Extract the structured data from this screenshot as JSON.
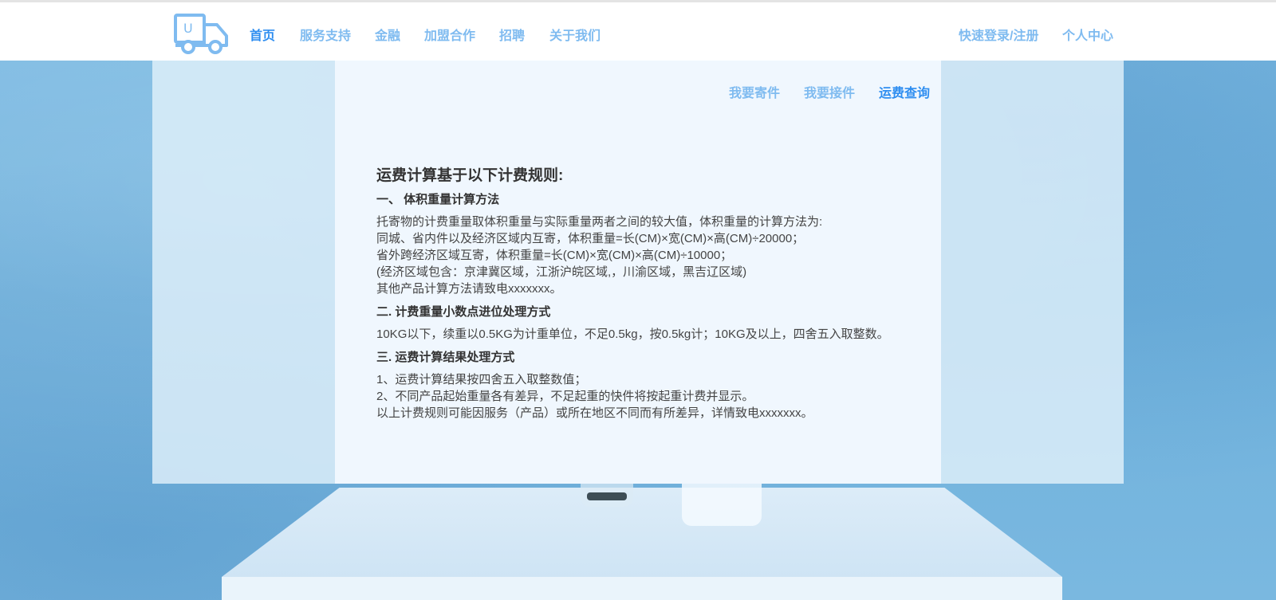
{
  "header": {
    "logo_letter": "U",
    "nav": [
      "首页",
      "服务支持",
      "金融",
      "加盟合作",
      "招聘",
      "关于我们"
    ],
    "active_index": 0,
    "login_label": "快速登录/注册",
    "user_center_label": "个人中心"
  },
  "subnav": {
    "items": [
      "我要寄件",
      "我要接件",
      "运费查询"
    ],
    "active_index": 2
  },
  "content": {
    "title": "运费计算基于以下计费规则:",
    "sections": [
      {
        "heading": "一、 体积重量计算方法",
        "lines": [
          "托寄物的计费重量取体积重量与实际重量两者之间的较大值，体积重量的计算方法为:",
          "同城、省内件以及经济区域内互寄，体积重量=长(CM)×宽(CM)×高(CM)÷20000；",
          "省外跨经济区域互寄，体积重量=长(CM)×宽(CM)×高(CM)÷10000；",
          "(经济区域包含：京津冀区域，江浙沪皖区域,，川渝区域，黑吉辽区域)",
          "其他产品计算方法请致电xxxxxxx。"
        ]
      },
      {
        "heading": "二. 计费重量小数点进位处理方式",
        "lines": [
          "10KG以下，续重以0.5KG为计重单位，不足0.5kg，按0.5kg计；10KG及以上，四舍五入取整数。"
        ]
      },
      {
        "heading": "三. 运费计算结果处理方式",
        "lines": [
          "1、运费计算结果按四舍五入取整数值；",
          "2、不同产品起始重量各有差异，不足起重的快件将按起重计费并显示。",
          "以上计费规则可能因服务（产品）或所在地区不同而有所差异，详情致电xxxxxxx。"
        ]
      }
    ]
  },
  "colors": {
    "nav_active": "#2f8ef0",
    "nav_inactive": "#7fbbf0",
    "logo": "#7fbbf0"
  }
}
